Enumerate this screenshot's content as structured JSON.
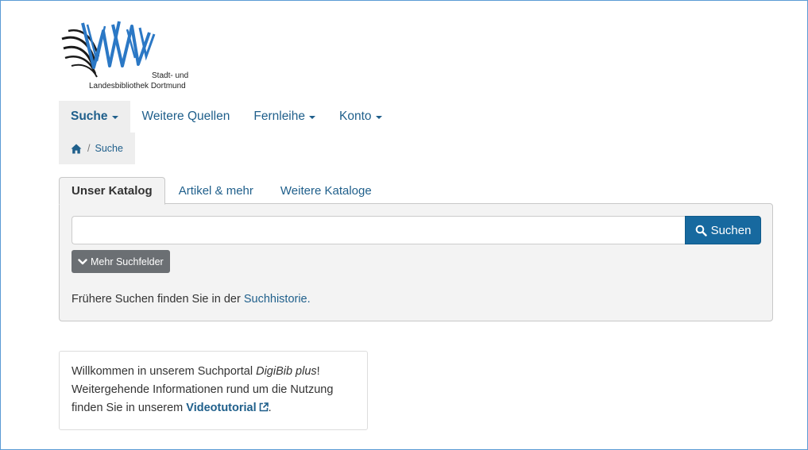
{
  "logo": {
    "line1": "Stadt- und",
    "line2": "Landesbibliothek Dortmund",
    "icon": "slb-logo-icon"
  },
  "nav": {
    "items": [
      {
        "label": "Suche",
        "active": true,
        "dropdown": true
      },
      {
        "label": "Weitere Quellen",
        "active": false,
        "dropdown": false
      },
      {
        "label": "Fernleihe",
        "active": false,
        "dropdown": true
      },
      {
        "label": "Konto",
        "active": false,
        "dropdown": true
      }
    ]
  },
  "breadcrumb": {
    "home_icon": "home-icon",
    "separator": "/",
    "current": "Suche"
  },
  "tabs": [
    {
      "label": "Unser Katalog",
      "active": true
    },
    {
      "label": "Artikel & mehr",
      "active": false
    },
    {
      "label": "Weitere Kataloge",
      "active": false
    }
  ],
  "search": {
    "value": "",
    "placeholder": "",
    "button_label": "Suchen",
    "button_icon": "search-icon",
    "more_fields_label": "Mehr Suchfelder",
    "more_fields_icon": "chevron-down-icon",
    "history_prefix": "Frühere Suchen finden Sie in der ",
    "history_link": "Suchhistorie."
  },
  "welcome": {
    "line1_prefix": "Willkommen in unserem Suchportal ",
    "portal_name": "DigiBib plus",
    "line1_suffix": "!",
    "line2": "Weitergehende Informationen rund um die Nutzung",
    "line3_prefix": "finden Sie in unserem ",
    "link": "Videotutorial",
    "link_icon": "external-link-icon",
    "line3_suffix": "."
  },
  "colors": {
    "link": "#1f5f8b",
    "primary_button": "#17699f",
    "secondary_button": "#6b6f73",
    "panel_bg": "#f3f3f3",
    "frame_border": "#5b9bd5"
  }
}
